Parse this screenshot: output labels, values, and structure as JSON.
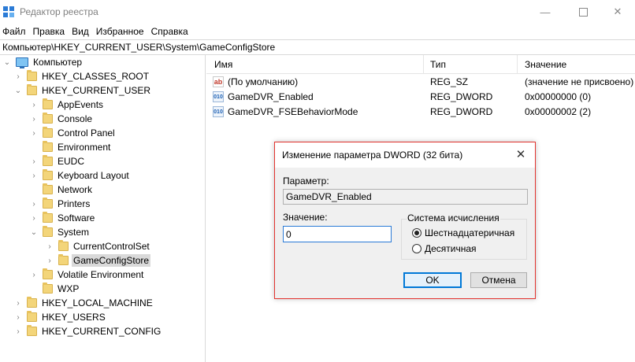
{
  "window": {
    "title": "Редактор реестра",
    "minimize_glyph": "—",
    "close_glyph": "✕"
  },
  "menu": [
    "Файл",
    "Правка",
    "Вид",
    "Избранное",
    "Справка"
  ],
  "address": "Компьютер\\HKEY_CURRENT_USER\\System\\GameConfigStore",
  "tree": {
    "root": "Компьютер",
    "items": [
      {
        "label": "HKEY_CLASSES_ROOT",
        "expander": "›"
      },
      {
        "label": "HKEY_CURRENT_USER",
        "expander": "⌄"
      },
      {
        "label": "AppEvents",
        "expander": "›"
      },
      {
        "label": "Console",
        "expander": "›"
      },
      {
        "label": "Control Panel",
        "expander": "›"
      },
      {
        "label": "Environment",
        "expander": ""
      },
      {
        "label": "EUDC",
        "expander": "›"
      },
      {
        "label": "Keyboard Layout",
        "expander": "›"
      },
      {
        "label": "Network",
        "expander": ""
      },
      {
        "label": "Printers",
        "expander": "›"
      },
      {
        "label": "Software",
        "expander": "›"
      },
      {
        "label": "System",
        "expander": "⌄"
      },
      {
        "label": "CurrentControlSet",
        "expander": "›"
      },
      {
        "label": "GameConfigStore",
        "expander": "›"
      },
      {
        "label": "Volatile Environment",
        "expander": "›"
      },
      {
        "label": "WXP",
        "expander": ""
      },
      {
        "label": "HKEY_LOCAL_MACHINE",
        "expander": "›"
      },
      {
        "label": "HKEY_USERS",
        "expander": "›"
      },
      {
        "label": "HKEY_CURRENT_CONFIG",
        "expander": "›"
      }
    ]
  },
  "list": {
    "columns": [
      "Имя",
      "Тип",
      "Значение"
    ],
    "rows": [
      {
        "icon": "ab",
        "name": "(По умолчанию)",
        "type": "REG_SZ",
        "value": "(значение не присвоено)"
      },
      {
        "icon": "010",
        "name": "GameDVR_Enabled",
        "type": "REG_DWORD",
        "value": "0x00000000 (0)"
      },
      {
        "icon": "010",
        "name": "GameDVR_FSEBehaviorMode",
        "type": "REG_DWORD",
        "value": "0x00000002 (2)"
      }
    ]
  },
  "dialog": {
    "title": "Изменение параметра DWORD (32 бита)",
    "close_glyph": "✕",
    "param_label": "Параметр:",
    "param_value": "GameDVR_Enabled",
    "value_label": "Значение:",
    "value": "0",
    "base_group": "Система исчисления",
    "radio_hex": "Шестнадцатеричная",
    "radio_dec": "Десятичная",
    "ok": "OK",
    "cancel": "Отмена"
  },
  "colors": {
    "dialog_border": "#e3342f",
    "default_button_border": "#0078d7",
    "folder": "#f3d57a"
  }
}
